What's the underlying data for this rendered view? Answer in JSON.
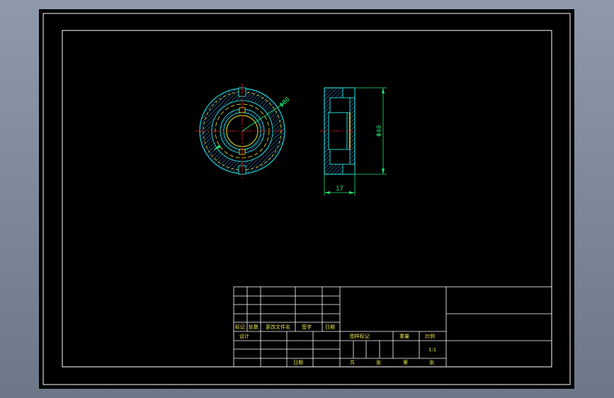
{
  "drawing": {
    "colors": {
      "background": "#000000",
      "frame": "#ffffff",
      "part_outline": "#20d0d0",
      "hatch": "#4aa0e0",
      "centerline": "#e02020",
      "dimension": "#20e070",
      "hidden": "#e8e830",
      "title_text": "#e8e850"
    },
    "front_view": {
      "diameter_label": "Φ80"
    },
    "side_view": {
      "height_label": "Φ40",
      "width_label": "17"
    },
    "title_block": {
      "revision_headers": [
        "标记",
        "处数",
        "更改文件名",
        "签字",
        "日期"
      ],
      "design_label": "设计",
      "date_label": "日期",
      "stage_mark_label": "图样标记",
      "weight_label": "重量",
      "scale_label": "比例",
      "scale_value": "1:1",
      "total_label": "共",
      "sheets_label": "张",
      "page_label": "第",
      "sheet_label": "张"
    }
  }
}
